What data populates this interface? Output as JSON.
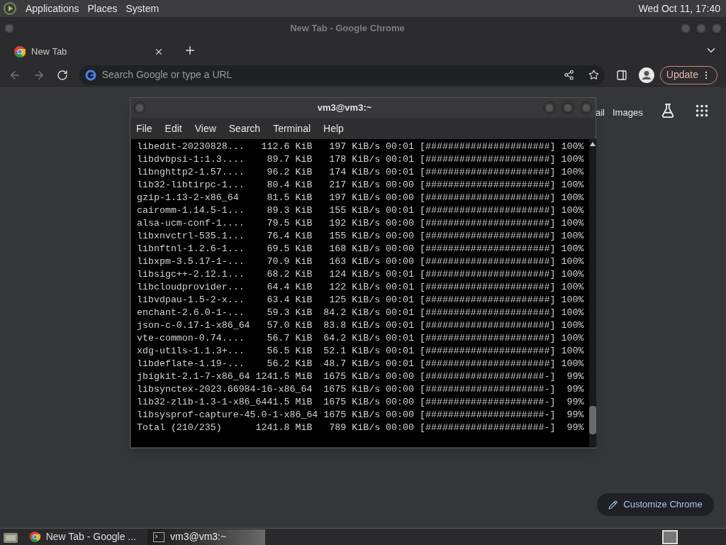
{
  "top_panel": {
    "menus": [
      "Applications",
      "Places",
      "System"
    ],
    "clock": "Wed Oct 11, 17:40"
  },
  "browser": {
    "title": "New Tab - Google Chrome",
    "tabs": [
      {
        "label": "New Tab",
        "selected": true
      }
    ],
    "address": {
      "placeholder": "Search Google or type a URL"
    },
    "update_button": "Update",
    "header_links": [
      "ail",
      "Images"
    ],
    "customize_button": "Customize Chrome"
  },
  "terminal": {
    "title": "vm3@vm3:~",
    "menus": [
      "File",
      "Edit",
      "View",
      "Search",
      "Terminal",
      "Help"
    ],
    "lines": [
      "libedit-20230828...   112.6 KiB   197 KiB/s 00:01 [######################] 100%",
      "libdvbpsi-1:1.3....    89.7 KiB   178 KiB/s 00:01 [######################] 100%",
      "libnghttp2-1.57....    96.2 KiB   174 KiB/s 00:01 [######################] 100%",
      "lib32-libtirpc-1...    80.4 KiB   217 KiB/s 00:00 [######################] 100%",
      "gzip-1.13-2-x86_64     81.5 KiB   197 KiB/s 00:00 [######################] 100%",
      "cairomm-1.14.5-1...    89.3 KiB   155 KiB/s 00:01 [######################] 100%",
      "alsa-ucm-conf-1....    79.5 KiB   192 KiB/s 00:00 [######################] 100%",
      "libxnvctrl-535.1...    76.4 KiB   155 KiB/s 00:00 [######################] 100%",
      "libnftnl-1.2.6-1...    69.5 KiB   168 KiB/s 00:00 [######################] 100%",
      "libxpm-3.5.17-1-...    70.9 KiB   163 KiB/s 00:00 [######################] 100%",
      "libsigc++-2.12.1...    68.2 KiB   124 KiB/s 00:01 [######################] 100%",
      "libcloudprovider...    64.4 KiB   122 KiB/s 00:01 [######################] 100%",
      "libvdpau-1.5-2-x...    63.4 KiB   125 KiB/s 00:01 [######################] 100%",
      "enchant-2.6.0-1-...    59.3 KiB  84.2 KiB/s 00:01 [######################] 100%",
      "json-c-0.17-1-x86_64   57.0 KiB  83.8 KiB/s 00:01 [######################] 100%",
      "vte-common-0.74....    56.7 KiB  64.2 KiB/s 00:01 [######################] 100%",
      "xdg-utils-1.1.3+...    56.5 KiB  52.1 KiB/s 00:01 [######################] 100%",
      "libdeflate-1.19-...    56.2 KiB  48.7 KiB/s 00:01 [######################] 100%",
      "jbigkit-2.1-7-x86_64 1241.5 MiB  1675 KiB/s 00:00 [#####################-]  99%",
      "libsynctex-2023.66984-16-x86_64  1675 KiB/s 00:00 [#####################-]  99%",
      "lib32-zlib-1.3-1-x86_6441.5 MiB  1675 KiB/s 00:00 [#####################-]  99%",
      "libsysprof-capture-45.0-1-x86_64 1675 KiB/s 00:00 [#####################-]  99%",
      "Total (210/235)      1241.8 MiB   789 KiB/s 00:00 [#####################-]  99%"
    ]
  },
  "taskbar": {
    "items": [
      {
        "label": "New Tab - Google ...",
        "selected": false,
        "kind": "browser"
      },
      {
        "label": "vm3@vm3:~",
        "selected": true,
        "kind": "terminal"
      }
    ]
  }
}
